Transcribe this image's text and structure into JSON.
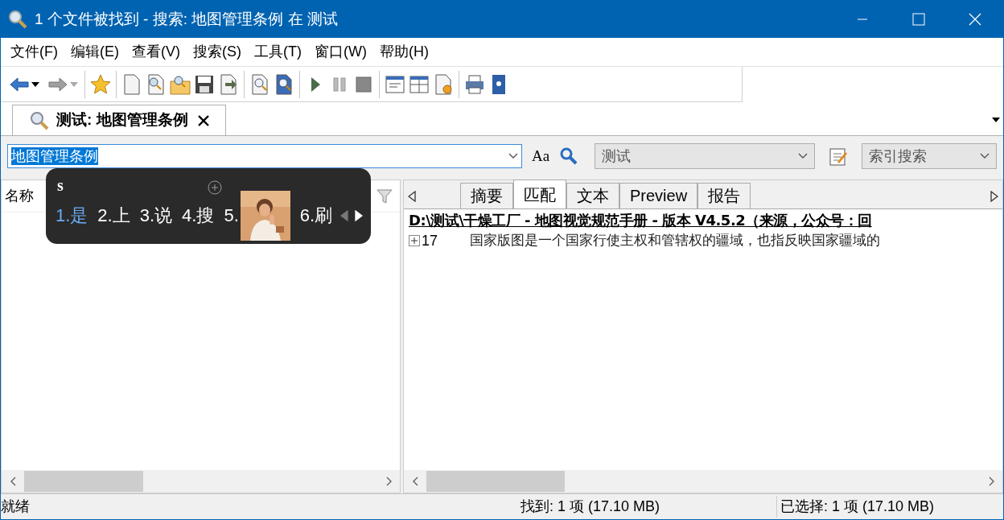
{
  "window": {
    "title": "1 个文件被找到 - 搜索: 地图管理条例 在 测试"
  },
  "menu": [
    "文件(F)",
    "编辑(E)",
    "查看(V)",
    "搜索(S)",
    "工具(T)",
    "窗口(W)",
    "帮助(H)"
  ],
  "doc_tabs": [
    {
      "label": "测试: 地图管理条例",
      "selected": true
    }
  ],
  "search": {
    "value": "地图管理条例",
    "case_label": "Aa",
    "location": "测试",
    "mode": "索引搜索"
  },
  "file_list": {
    "column": "名称"
  },
  "result_tabs": [
    {
      "label": "摘要",
      "selected": false
    },
    {
      "label": "匹配",
      "selected": true
    },
    {
      "label": "文本",
      "selected": false
    },
    {
      "label": "Preview",
      "selected": false
    },
    {
      "label": "报告",
      "selected": false
    }
  ],
  "result": {
    "path": "D:\\测试\\干燥工厂 - 地图视觉规范手册 - 版本 V4.5.2（来源，公众号：回",
    "lines": [
      {
        "number": "17",
        "text": "国家版图是一个国家行使主权和管辖权的疆域，也指反映国家疆域的"
      }
    ]
  },
  "status_bar": [
    "就绪",
    "找到: 1 项 (17.10 MB)",
    "已选择: 1 项 (17.10 MB)"
  ],
  "ime": {
    "input": "s",
    "candidates": [
      {
        "label": "1.是",
        "selected": true
      },
      {
        "label": "2.上",
        "selected": false
      },
      {
        "label": "3.说",
        "selected": false
      },
      {
        "label": "4.搜",
        "selected": false
      },
      {
        "label": "5.",
        "selected": false,
        "kind": "picture"
      },
      {
        "label": "6.刷",
        "selected": false
      }
    ]
  }
}
